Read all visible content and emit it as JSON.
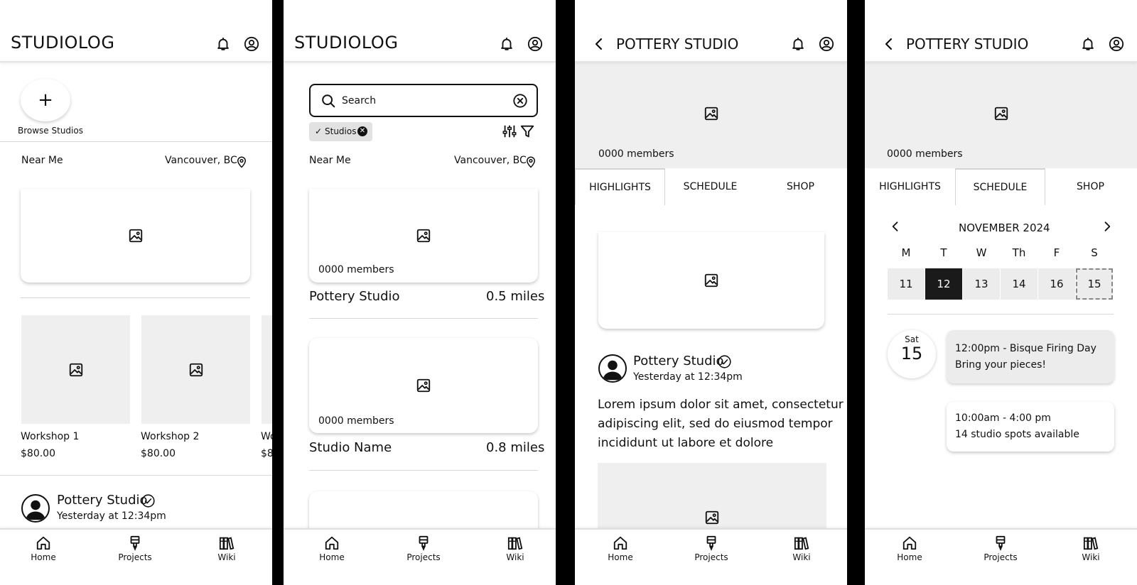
{
  "app": {
    "brand": "STUDIOLOG"
  },
  "nav": {
    "home": "Home",
    "projects": "Projects",
    "wiki": "Wiki"
  },
  "screen1": {
    "browse_label": "Browse Studios",
    "near_me": "Near Me",
    "location": "Vancouver, BC",
    "workshops": [
      {
        "name": "Workshop 1",
        "price": "$80.00"
      },
      {
        "name": "Workshop 2",
        "price": "$80.00"
      },
      {
        "name": "Wo",
        "price": "$8"
      }
    ],
    "post": {
      "author": "Pottery Studio",
      "time": "Yesterday at 12:34pm"
    }
  },
  "screen2": {
    "search_placeholder": "Search",
    "filter_chip": "Studios",
    "near_me": "Near Me",
    "location": "Vancouver, BC",
    "results": [
      {
        "members": "0000 members",
        "name": "Pottery Studio",
        "distance": "0.5 miles"
      },
      {
        "members": "0000 members",
        "name": "Studio Name",
        "distance": "0.8 miles"
      }
    ]
  },
  "screen3": {
    "title": "POTTERY STUDIO",
    "members": "0000 members",
    "tabs": [
      "HIGHLIGHTS",
      "SCHEDULE",
      "SHOP"
    ],
    "post": {
      "author": "Pottery Studio",
      "time": "Yesterday at 12:34pm",
      "body_lines": [
        "Lorem ipsum dolor sit amet, consectetur",
        "adipiscing elit, sed do eiusmod tempor",
        "incididunt ut labore et dolore"
      ]
    }
  },
  "screen4": {
    "title": "POTTERY STUDIO",
    "members": "0000 members",
    "tabs": [
      "HIGHLIGHTS",
      "SCHEDULE",
      "SHOP"
    ],
    "month": "NOVEMBER 2024",
    "weekdays": [
      "M",
      "T",
      "W",
      "Th",
      "F",
      "S"
    ],
    "days": [
      "11",
      "12",
      "13",
      "14",
      "16",
      "15"
    ],
    "date_badge": {
      "dow": "Sat",
      "day": "15"
    },
    "events": [
      {
        "line1": "12:00pm - Bisque Firing Day",
        "line2": "Bring your pieces!"
      },
      {
        "line1": "10:00am - 4:00 pm",
        "line2": "14 studio spots available"
      }
    ]
  }
}
